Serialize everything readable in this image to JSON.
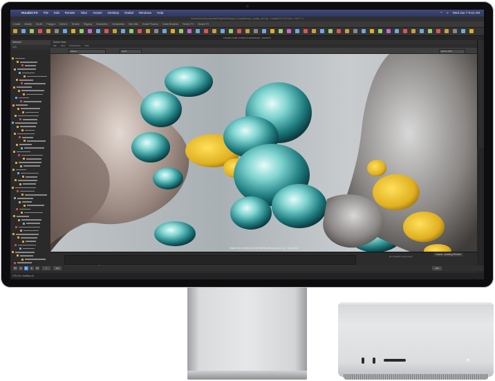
{
  "menubar": {
    "app": "Houdini FX",
    "items": [
      "Houdini FX",
      "File",
      "Edit",
      "Render",
      "Tabs",
      "Assets",
      "Desktop",
      "Radial",
      "Windows",
      "Help"
    ],
    "clock": "Wed Jun 7  9:41 AM"
  },
  "window": {
    "path_title": "/Users/user/Documents/Projects/Viewport_Crystal/comp_crystal_sim.hip - Houdini FX 20.0.514 - RLS 7.1",
    "title": "Houdini Indie Limited-Commercial - scene01"
  },
  "toolbar": {
    "tabs": [
      "Create",
      "Modify",
      "Model",
      "Polygon",
      "Deform",
      "Texture",
      "Rigging",
      "Characters",
      "Constraints",
      "Hair Utils",
      "Guide Process",
      "Guide Brushes",
      "Terrain FX",
      "Simple FX"
    ]
  },
  "left_panel": {
    "header": "Network",
    "path": "/obj"
  },
  "viewport": {
    "tab": "Scene View",
    "menu": [
      "File",
      "View",
      "Preferences",
      "Help"
    ],
    "camera_select": "Karma",
    "display_select": "cam1",
    "render_select": "Karma XPU",
    "caption": "Frame 193, 2560x1440 (8.2MB 80.40ms) (frame 1s) · 2x4 AOVs",
    "scene_label": "Scene, shading Render"
  },
  "timeline": {
    "start": "1",
    "end": "240",
    "current": "193",
    "message": "No networks in the scene"
  },
  "statusbar": {
    "text": "OGL/GL shading ok"
  },
  "colors": {
    "accent": "#3e8ee0",
    "highlight_yellow": "#e0b020"
  }
}
